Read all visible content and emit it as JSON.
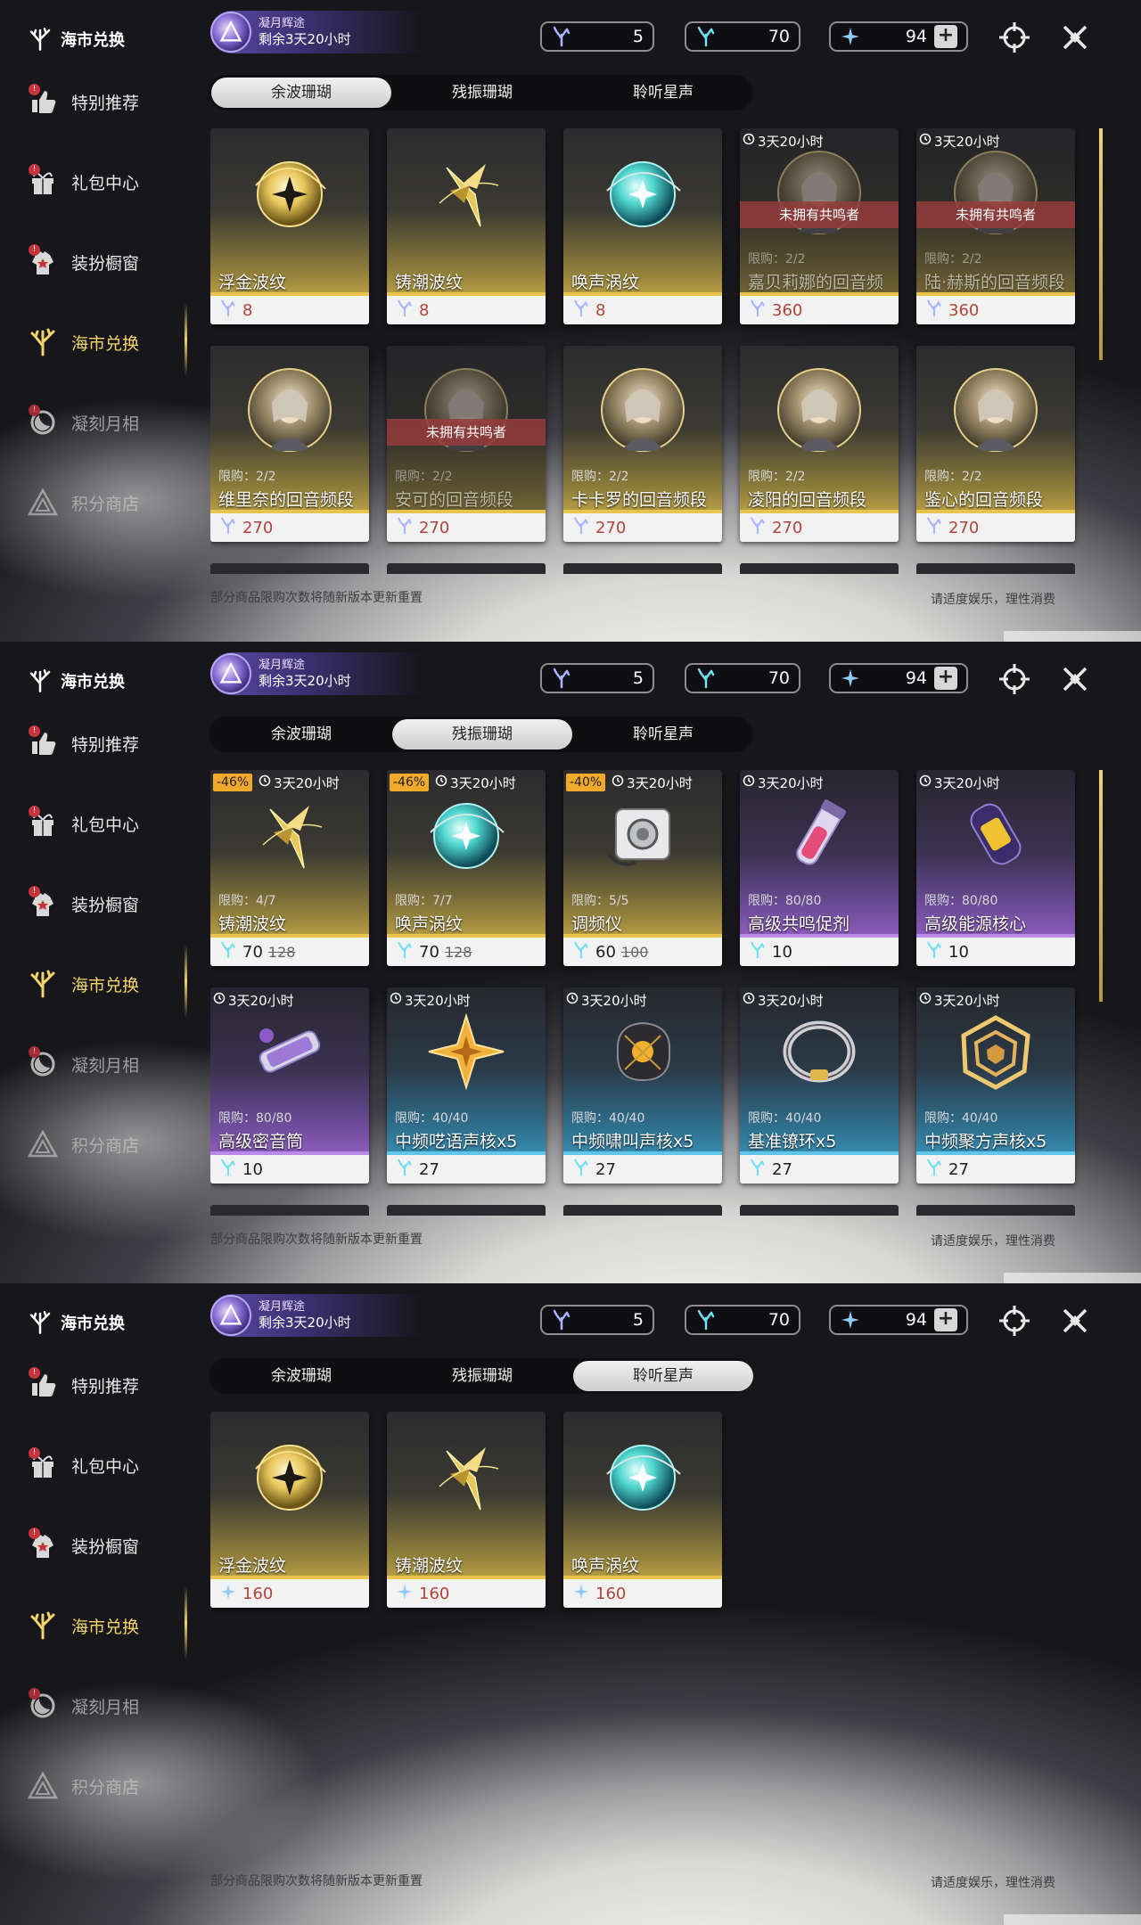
{
  "side": {
    "title": "海市兑换",
    "items": [
      {
        "label": "特别推荐",
        "icon": "thumbs-up-icon",
        "badge": "!"
      },
      {
        "label": "礼包中心",
        "icon": "gift-icon",
        "badge": "!"
      },
      {
        "label": "装扮橱窗",
        "icon": "outfit-icon",
        "badge": "!"
      },
      {
        "label": "海市兑换",
        "icon": "coral-icon",
        "badge": ""
      },
      {
        "label": "凝刻月相",
        "icon": "moon-icon",
        "badge": "!"
      },
      {
        "label": "积分商店",
        "icon": "triangle-icon",
        "badge": ""
      }
    ]
  },
  "event": {
    "line1": "凝月辉途",
    "line2": "剩余3天20小时"
  },
  "currency": {
    "c1": "5",
    "c2": "70",
    "c3": "94",
    "plus": "+"
  },
  "tabs": [
    "余波珊瑚",
    "残振珊瑚",
    "聆听星声"
  ],
  "footer": {
    "left": "部分商品限购次数将随新版本更新重置",
    "right": "请适度娱乐，理性消费"
  },
  "colors": {
    "gold": "#e7c44e",
    "purple": "#b98ae8",
    "blue": "#5fc6ea",
    "price_red": "#b0433a",
    "active_text": "#f3d36a"
  },
  "panels": [
    {
      "selected_tab": 0,
      "cards": [
        {
          "name": "浮金波纹",
          "price": "8",
          "price_red": true,
          "theme": "gold",
          "art": "gold-orb"
        },
        {
          "name": "铸潮波纹",
          "price": "8",
          "price_red": true,
          "theme": "gold",
          "art": "gold-blade"
        },
        {
          "name": "唤声涡纹",
          "price": "8",
          "price_red": true,
          "theme": "gold",
          "art": "teal-orb"
        },
        {
          "name": "嘉贝莉娜的回音频段",
          "price": "360",
          "price_red": true,
          "theme": "gold",
          "art": "portrait",
          "timer": "3天20小时",
          "limit": "限购：2/2",
          "banner": "未拥有共鸣者",
          "locked": true
        },
        {
          "name": "陆·赫斯的回音频段",
          "price": "360",
          "price_red": true,
          "theme": "gold",
          "art": "portrait",
          "timer": "3天20小时",
          "limit": "限购：2/2",
          "banner": "未拥有共鸣者",
          "locked": true
        },
        {
          "name": "维里奈的回音频段",
          "price": "270",
          "price_red": true,
          "theme": "gold",
          "art": "portrait",
          "limit": "限购：2/2"
        },
        {
          "name": "安可的回音频段",
          "price": "270",
          "price_red": true,
          "theme": "gold",
          "art": "portrait",
          "limit": "限购：2/2",
          "banner": "未拥有共鸣者",
          "locked": true
        },
        {
          "name": "卡卡罗的回音频段",
          "price": "270",
          "price_red": true,
          "theme": "gold",
          "art": "portrait",
          "limit": "限购：2/2"
        },
        {
          "name": "凌阳的回音频段",
          "price": "270",
          "price_red": true,
          "theme": "gold",
          "art": "portrait",
          "limit": "限购：2/2"
        },
        {
          "name": "鉴心的回音频段",
          "price": "270",
          "price_red": true,
          "theme": "gold",
          "art": "portrait",
          "limit": "限购：2/2"
        }
      ]
    },
    {
      "selected_tab": 1,
      "cards": [
        {
          "name": "铸潮波纹",
          "price": "70",
          "old_price": "128",
          "theme": "gold",
          "art": "gold-blade",
          "timer": "3天20小时",
          "discount": "-46%",
          "limit": "限购：4/7"
        },
        {
          "name": "唤声涡纹",
          "price": "70",
          "old_price": "128",
          "theme": "gold",
          "art": "teal-orb",
          "timer": "3天20小时",
          "discount": "-46%",
          "limit": "限购：7/7"
        },
        {
          "name": "调频仪",
          "price": "60",
          "old_price": "100",
          "theme": "gold",
          "art": "device",
          "timer": "3天20小时",
          "discount": "-40%",
          "limit": "限购：5/5"
        },
        {
          "name": "高级共鸣促剂",
          "price": "10",
          "theme": "purple",
          "art": "vial",
          "timer": "3天20小时",
          "limit": "限购：80/80"
        },
        {
          "name": "高级能源核心",
          "price": "10",
          "theme": "purple",
          "art": "capsule",
          "timer": "3天20小时",
          "limit": "限购：80/80"
        },
        {
          "name": "高级密音筒",
          "price": "10",
          "theme": "purple",
          "art": "cylinder",
          "timer": "3天20小时",
          "limit": "限购：80/80"
        },
        {
          "name": "中频呓语声核x5",
          "price": "27",
          "theme": "blue",
          "art": "star-core",
          "timer": "3天20小时",
          "limit": "限购：40/40"
        },
        {
          "name": "中频啸叫声核x5",
          "price": "27",
          "theme": "blue",
          "art": "dark-core",
          "timer": "3天20小时",
          "limit": "限购：40/40"
        },
        {
          "name": "基准镣环x5",
          "price": "27",
          "theme": "blue",
          "art": "ring",
          "timer": "3天20小时",
          "limit": "限购：40/40"
        },
        {
          "name": "中频聚方声核x5",
          "price": "27",
          "theme": "blue",
          "art": "gold-square",
          "timer": "3天20小时",
          "limit": "限购：40/40"
        }
      ]
    },
    {
      "selected_tab": 2,
      "cards": [
        {
          "name": "浮金波纹",
          "price": "160",
          "price_red": true,
          "theme": "gold",
          "art": "gold-orb",
          "star": true
        },
        {
          "name": "铸潮波纹",
          "price": "160",
          "price_red": true,
          "theme": "gold",
          "art": "gold-blade",
          "star": true
        },
        {
          "name": "唤声涡纹",
          "price": "160",
          "price_red": true,
          "theme": "gold",
          "art": "teal-orb",
          "star": true
        }
      ]
    }
  ]
}
